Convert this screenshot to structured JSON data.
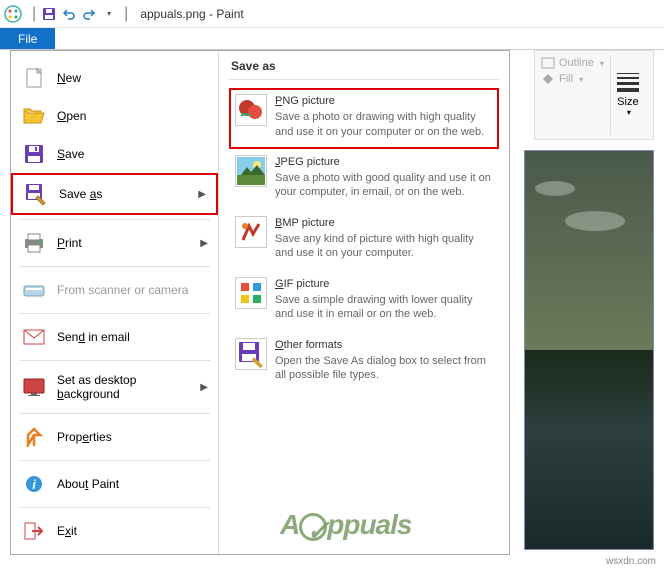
{
  "title": "appuals.png - Paint",
  "file_tab": "File",
  "left_menu": {
    "new": "New",
    "open": "Open",
    "save": "Save",
    "save_as": "Save as",
    "print": "Print",
    "scanner": "From scanner or camera",
    "email": "Send in email",
    "desktop_bg": "Set as desktop background",
    "properties": "Properties",
    "about": "About Paint",
    "exit": "Exit"
  },
  "submenu": {
    "title": "Save as",
    "png": {
      "title": "PNG picture",
      "desc": "Save a photo or drawing with high quality and use it on your computer or on the web."
    },
    "jpeg": {
      "title": "JPEG picture",
      "desc": "Save a photo with good quality and use it on your computer, in email, or on the web."
    },
    "bmp": {
      "title": "BMP picture",
      "desc": "Save any kind of picture with high quality and use it on your computer."
    },
    "gif": {
      "title": "GIF picture",
      "desc": "Save a simple drawing with lower quality and use it in email or on the web."
    },
    "other": {
      "title": "Other formats",
      "desc": "Open the Save As dialog box to select from all possible file types."
    }
  },
  "ribbon": {
    "outline": "Outline",
    "fill": "Fill",
    "size": "Size"
  },
  "watermark": "ppuals",
  "footer": "wsxdn.com"
}
